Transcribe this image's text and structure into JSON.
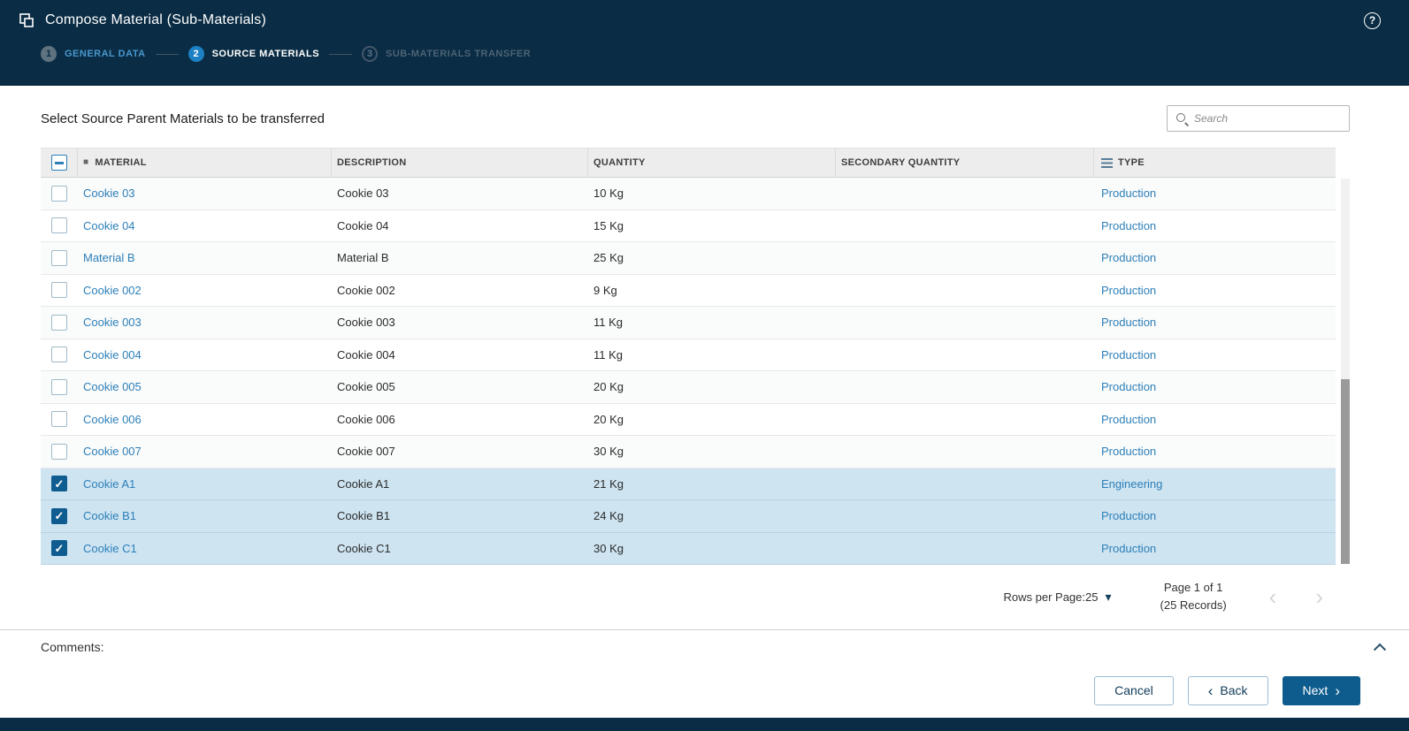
{
  "header": {
    "title": "Compose Material (Sub-Materials)"
  },
  "stepper": {
    "steps": [
      {
        "number": "1",
        "label": "GENERAL DATA",
        "state": "completed"
      },
      {
        "number": "2",
        "label": "SOURCE MATERIALS",
        "state": "active"
      },
      {
        "number": "3",
        "label": "SUB-MATERIALS TRANSFER",
        "state": "upcoming"
      }
    ]
  },
  "content": {
    "section_title": "Select Source Parent Materials to be transferred",
    "search_placeholder": "Search"
  },
  "table": {
    "columns": [
      "MATERIAL",
      "DESCRIPTION",
      "QUANTITY",
      "SECONDARY QUANTITY",
      "TYPE"
    ],
    "rows": [
      {
        "material": "Cookie 03",
        "description": "Cookie 03",
        "quantity": "10 Kg",
        "secondary_quantity": "",
        "type": "Production",
        "selected": false
      },
      {
        "material": "Cookie 04",
        "description": "Cookie 04",
        "quantity": "15 Kg",
        "secondary_quantity": "",
        "type": "Production",
        "selected": false
      },
      {
        "material": "Material B",
        "description": "Material B",
        "quantity": "25 Kg",
        "secondary_quantity": "",
        "type": "Production",
        "selected": false
      },
      {
        "material": "Cookie 002",
        "description": "Cookie 002",
        "quantity": "9 Kg",
        "secondary_quantity": "",
        "type": "Production",
        "selected": false
      },
      {
        "material": "Cookie 003",
        "description": "Cookie 003",
        "quantity": "11 Kg",
        "secondary_quantity": "",
        "type": "Production",
        "selected": false
      },
      {
        "material": "Cookie 004",
        "description": "Cookie 004",
        "quantity": "11 Kg",
        "secondary_quantity": "",
        "type": "Production",
        "selected": false
      },
      {
        "material": "Cookie 005",
        "description": "Cookie 005",
        "quantity": "20 Kg",
        "secondary_quantity": "",
        "type": "Production",
        "selected": false
      },
      {
        "material": "Cookie 006",
        "description": "Cookie 006",
        "quantity": "20 Kg",
        "secondary_quantity": "",
        "type": "Production",
        "selected": false
      },
      {
        "material": "Cookie 007",
        "description": "Cookie 007",
        "quantity": "30 Kg",
        "secondary_quantity": "",
        "type": "Production",
        "selected": false
      },
      {
        "material": "Cookie A1",
        "description": "Cookie A1",
        "quantity": "21 Kg",
        "secondary_quantity": "",
        "type": "Engineering",
        "selected": true
      },
      {
        "material": "Cookie B1",
        "description": "Cookie B1",
        "quantity": "24 Kg",
        "secondary_quantity": "",
        "type": "Production",
        "selected": true
      },
      {
        "material": "Cookie C1",
        "description": "Cookie C1",
        "quantity": "30 Kg",
        "secondary_quantity": "",
        "type": "Production",
        "selected": true
      }
    ]
  },
  "pagination": {
    "rows_per_page_label": "Rows per Page:",
    "rows_per_page_value": "25",
    "page_info": "Page 1 of 1",
    "records_info": "(25 Records)"
  },
  "comments": {
    "label": "Comments:"
  },
  "footer": {
    "cancel_label": "Cancel",
    "back_label": "Back",
    "next_label": "Next"
  },
  "icons": {
    "help": "?",
    "material_column": "■",
    "caret_down": "▾",
    "chevron_left": "‹",
    "chevron_right": "›"
  },
  "colors": {
    "header_bg": "#0A2C44",
    "active_step_blue": "#1D80C4",
    "link_blue": "#2D7FB8",
    "selected_row_bg": "#CEE4F1",
    "primary_button_bg": "#0E5C8D",
    "checked_checkbox_bg": "#0F5C90"
  }
}
